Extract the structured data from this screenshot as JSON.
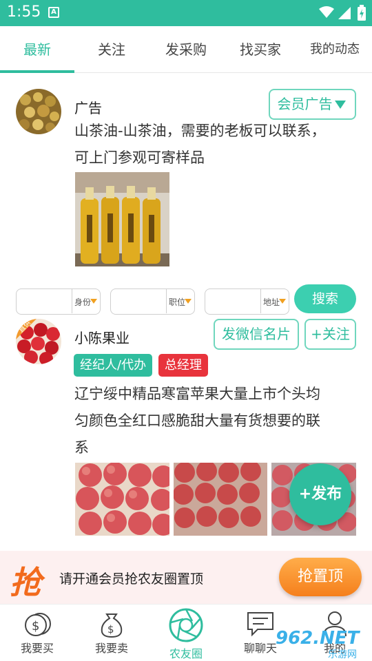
{
  "status_bar": {
    "time": "1:55",
    "app_icon_letter": "A"
  },
  "tabs": [
    {
      "label": "最新",
      "active": true
    },
    {
      "label": "关注"
    },
    {
      "label": "发采购"
    },
    {
      "label": "找买家"
    },
    {
      "label": "我的动态"
    }
  ],
  "ad_post": {
    "username": "广告",
    "badge_label": "会员广告",
    "text_line1": "山茶油-山茶油，需要的老板可以联系，",
    "text_line2": "可上门参观可寄样品"
  },
  "filters": {
    "identity_label": "身份",
    "position_label": "职位",
    "address_label": "地址",
    "search_label": "搜索"
  },
  "post": {
    "username": "小陈果业",
    "wechat_card_label": "发微信名片",
    "follow_label": "+关注",
    "tag_role": "经纪人/代办",
    "tag_title": "总经理",
    "text_line1": "辽宁绥中精品寒富苹果大量上市个头均",
    "text_line2": "匀颜色全红口感脆甜大量有货想要的联",
    "text_line3": "系"
  },
  "fab_label": "+发布",
  "promo": {
    "icon_char": "抢",
    "text": "请开通会员抢农友圈置顶",
    "button_label": "抢置顶"
  },
  "bottom_nav": [
    {
      "label": "我要买",
      "icon": "dollar-bag-icon"
    },
    {
      "label": "我要卖",
      "icon": "money-bag-icon"
    },
    {
      "label": "农友圈",
      "icon": "aperture-icon",
      "active": true
    },
    {
      "label": "聊聊天",
      "icon": "chat-icon"
    },
    {
      "label": "我的",
      "icon": "person-icon"
    }
  ],
  "watermark": {
    "main": "962.NET",
    "sub": "乐游网"
  },
  "colors": {
    "accent": "#2fbd9e",
    "orange": "#f57f1c",
    "tag_green": "#2fbd9e",
    "tag_red": "#e8333c"
  }
}
